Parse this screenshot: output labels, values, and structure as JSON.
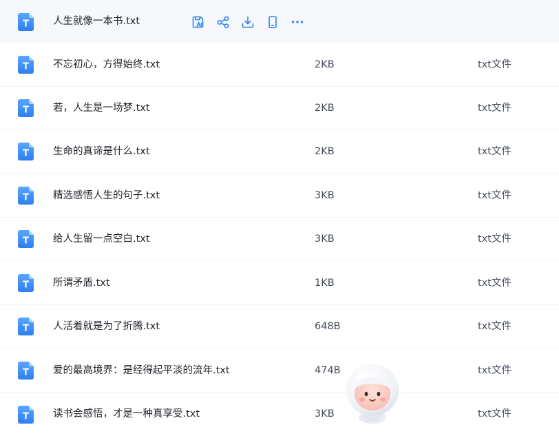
{
  "files": [
    {
      "name": "人生就像一本书.txt",
      "size": "",
      "type": ""
    },
    {
      "name": "不忘初心，方得始终.txt",
      "size": "2KB",
      "type": "txt文件"
    },
    {
      "name": "若，人生是一场梦.txt",
      "size": "2KB",
      "type": "txt文件"
    },
    {
      "name": "生命的真谛是什么.txt",
      "size": "2KB",
      "type": "txt文件"
    },
    {
      "name": "精选感悟人生的句子.txt",
      "size": "3KB",
      "type": "txt文件"
    },
    {
      "name": "给人生留一点空白.txt",
      "size": "3KB",
      "type": "txt文件"
    },
    {
      "name": "所谓矛盾.txt",
      "size": "1KB",
      "type": "txt文件"
    },
    {
      "name": "人活着就是为了折腾.txt",
      "size": "648B",
      "type": "txt文件"
    },
    {
      "name": "爱的最高境界：是经得起平淡的流年.txt",
      "size": "474B",
      "type": "txt文件"
    },
    {
      "name": "读书会感悟，才是一种真享受.txt",
      "size": "3KB",
      "type": "txt文件"
    }
  ],
  "row_actions": [
    "save-to-drive-icon",
    "share-icon",
    "download-icon",
    "phone-icon",
    "more-icon"
  ],
  "colors": {
    "icon_blue": "#3a8cf5",
    "action_blue": "#2b84f7",
    "hover_bg": "#f6f8fc"
  }
}
